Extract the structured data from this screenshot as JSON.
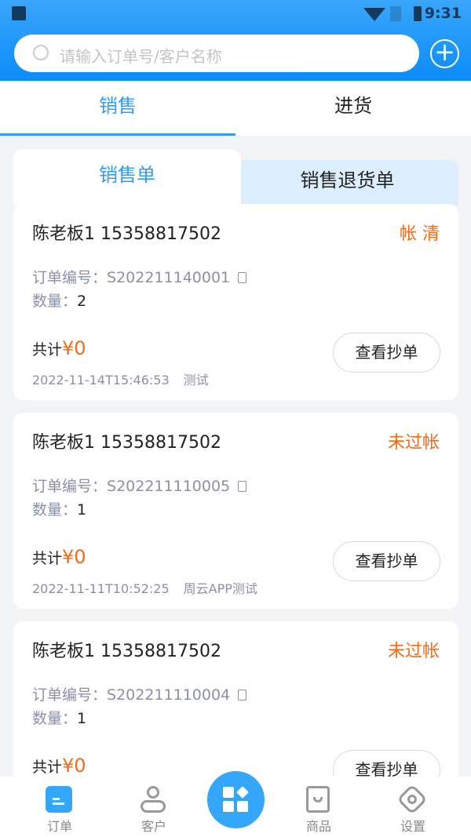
{
  "status_bar": {
    "time": "9:31"
  },
  "search": {
    "placeholder": "请输入订单号/客户名称"
  },
  "tabs": [
    {
      "label": "销售",
      "active": true
    },
    {
      "label": "进货",
      "active": false
    }
  ],
  "subtabs": [
    {
      "label": "销售单",
      "active": true
    },
    {
      "label": "销售退货单",
      "active": false
    }
  ],
  "colors": {
    "accent": "#2f9cf4",
    "status": "#f56a15"
  },
  "orders": [
    {
      "customer": "陈老板1 15358817502",
      "status": "帐 清",
      "order_label": "订单编号：",
      "order_no": "S202211140001",
      "qty_label": "数量：",
      "qty": "2",
      "total_label": "共计",
      "total": "¥0",
      "datetime": "2022-11-14T15:46:53",
      "note": "测试",
      "button": "查看抄单"
    },
    {
      "customer": "陈老板1 15358817502",
      "status": "未过帐",
      "order_label": "订单编号：",
      "order_no": "S202211110005",
      "qty_label": "数量：",
      "qty": "1",
      "total_label": "共计",
      "total": "¥0",
      "datetime": "2022-11-11T10:52:25",
      "note": "周云APP测试",
      "button": "查看抄单"
    },
    {
      "customer": "陈老板1 15358817502",
      "status": "未过帐",
      "order_label": "订单编号：",
      "order_no": "S202211110004",
      "qty_label": "数量：",
      "qty": "1",
      "total_label": "共计",
      "total": "¥0",
      "datetime": "",
      "note": "",
      "button": "查看抄单"
    }
  ],
  "nav": [
    {
      "label": "订单",
      "icon": "order-icon",
      "active": true
    },
    {
      "label": "客户",
      "icon": "customer-icon"
    },
    {
      "label": "",
      "icon": "apps-icon"
    },
    {
      "label": "商品",
      "icon": "bag-icon"
    },
    {
      "label": "设置",
      "icon": "settings-icon"
    }
  ]
}
